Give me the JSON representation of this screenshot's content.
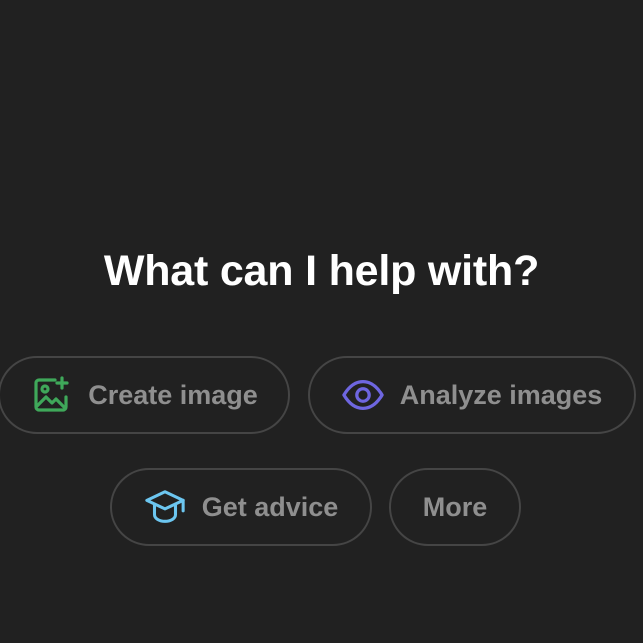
{
  "headline": "What can I help with?",
  "chips": {
    "create_image": {
      "label": "Create image",
      "icon": "image-sparkle-icon",
      "icon_color": "#3fa85a"
    },
    "analyze_images": {
      "label": "Analyze images",
      "icon": "eye-icon",
      "icon_color": "#6e66e0"
    },
    "get_advice": {
      "label": "Get advice",
      "icon": "graduation-cap-icon",
      "icon_color": "#6cc6f0"
    },
    "more": {
      "label": "More"
    }
  },
  "colors": {
    "background": "#212121",
    "headline": "#ffffff",
    "chip_text": "#8f8f8f",
    "chip_border": "#454545"
  }
}
